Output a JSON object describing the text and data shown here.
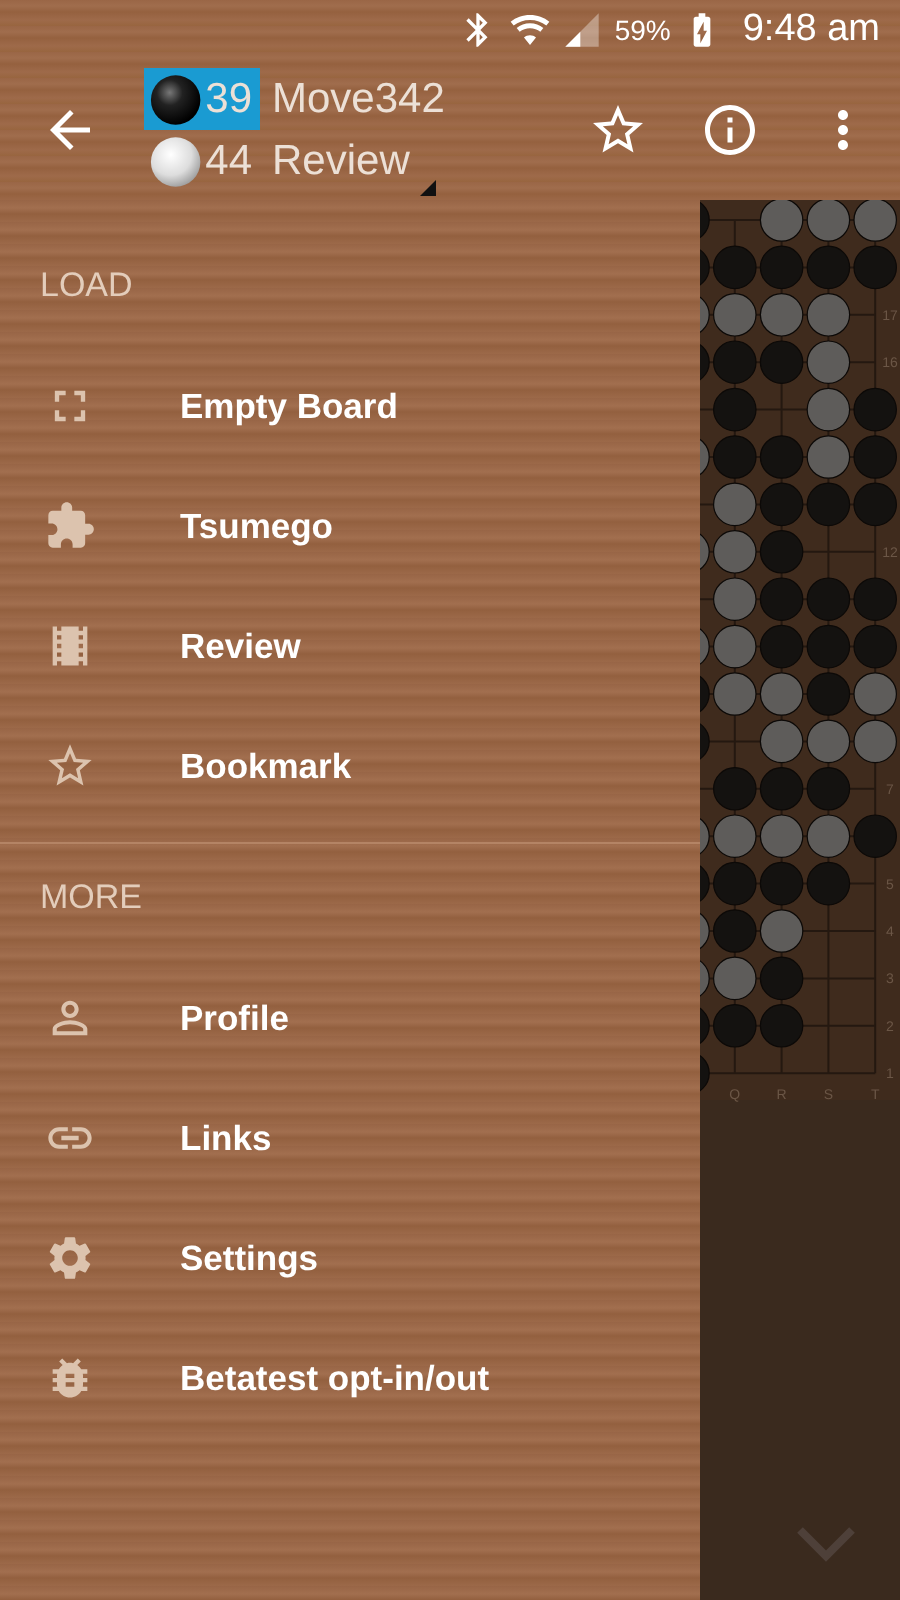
{
  "status_bar": {
    "battery": "59%",
    "time": "9:48 am"
  },
  "toolbar": {
    "players": [
      {
        "kind": "black",
        "captures": "39",
        "selected": true,
        "caption": "Move342"
      },
      {
        "kind": "white",
        "captures": "44",
        "selected": false,
        "caption": "Review"
      }
    ]
  },
  "drawer": {
    "sections": [
      {
        "header": "LOAD",
        "items": [
          {
            "label": "Empty Board"
          },
          {
            "label": "Tsumego"
          },
          {
            "label": "Review"
          },
          {
            "label": "Bookmark"
          }
        ]
      },
      {
        "header": "MORE",
        "items": [
          {
            "label": "Profile"
          },
          {
            "label": "Links"
          },
          {
            "label": "Settings"
          },
          {
            "label": "Betatest opt-in/out"
          }
        ]
      }
    ]
  },
  "board": {
    "column_labels": [
      "Q",
      "R",
      "S",
      "T"
    ],
    "rows": [
      {
        "cells": [
          {
            "kind": "black"
          },
          {
            "kind": "empty"
          },
          {
            "kind": "white"
          },
          {
            "kind": "white"
          },
          {
            "kind": "white"
          }
        ]
      },
      {
        "cells": [
          {
            "kind": "black"
          },
          {
            "kind": "black"
          },
          {
            "kind": "black"
          },
          {
            "kind": "black"
          },
          {
            "kind": "black"
          }
        ]
      },
      {
        "cells": [
          {
            "kind": "white"
          },
          {
            "kind": "white"
          },
          {
            "kind": "white"
          },
          {
            "kind": "white"
          },
          {
            "kind": "empty"
          }
        ],
        "label": "17"
      },
      {
        "cells": [
          {
            "kind": "black"
          },
          {
            "kind": "black"
          },
          {
            "kind": "black"
          },
          {
            "kind": "white"
          },
          {
            "kind": "empty"
          }
        ],
        "label": "16"
      },
      {
        "cells": [
          {
            "kind": "empty"
          },
          {
            "kind": "black"
          },
          {
            "kind": "empty"
          },
          {
            "kind": "white"
          },
          {
            "kind": "black"
          }
        ]
      },
      {
        "cells": [
          {
            "kind": "white"
          },
          {
            "kind": "black"
          },
          {
            "kind": "black"
          },
          {
            "kind": "white"
          },
          {
            "kind": "black"
          }
        ]
      },
      {
        "cells": [
          {
            "kind": "empty"
          },
          {
            "kind": "white"
          },
          {
            "kind": "black"
          },
          {
            "kind": "black"
          },
          {
            "kind": "black"
          }
        ]
      },
      {
        "cells": [
          {
            "kind": "white"
          },
          {
            "kind": "white"
          },
          {
            "kind": "black"
          },
          {
            "kind": "empty"
          },
          {
            "kind": "empty"
          }
        ],
        "label": "12"
      },
      {
        "cells": [
          {
            "kind": "empty"
          },
          {
            "kind": "white"
          },
          {
            "kind": "black"
          },
          {
            "kind": "black"
          },
          {
            "kind": "black"
          }
        ]
      },
      {
        "cells": [
          {
            "kind": "white"
          },
          {
            "kind": "white"
          },
          {
            "kind": "black"
          },
          {
            "kind": "black"
          },
          {
            "kind": "black"
          }
        ]
      },
      {
        "cells": [
          {
            "kind": "black"
          },
          {
            "kind": "white"
          },
          {
            "kind": "white"
          },
          {
            "kind": "black"
          },
          {
            "kind": "white"
          }
        ]
      },
      {
        "cells": [
          {
            "kind": "black"
          },
          {
            "kind": "empty"
          },
          {
            "kind": "white"
          },
          {
            "kind": "white"
          },
          {
            "kind": "white"
          }
        ]
      },
      {
        "cells": [
          {
            "kind": "empty"
          },
          {
            "kind": "black"
          },
          {
            "kind": "black"
          },
          {
            "kind": "black"
          },
          {
            "kind": "empty"
          }
        ],
        "label": "7"
      },
      {
        "cells": [
          {
            "kind": "white"
          },
          {
            "kind": "white"
          },
          {
            "kind": "white"
          },
          {
            "kind": "white"
          },
          {
            "kind": "black"
          }
        ]
      },
      {
        "cells": [
          {
            "kind": "black"
          },
          {
            "kind": "black"
          },
          {
            "kind": "black"
          },
          {
            "kind": "black"
          },
          {
            "kind": "empty"
          }
        ],
        "label": "5"
      },
      {
        "cells": [
          {
            "kind": "white"
          },
          {
            "kind": "black"
          },
          {
            "kind": "white"
          },
          {
            "kind": "empty"
          },
          {
            "kind": "empty"
          }
        ],
        "label": "4"
      },
      {
        "cells": [
          {
            "kind": "white"
          },
          {
            "kind": "white"
          },
          {
            "kind": "black"
          },
          {
            "kind": "empty"
          },
          {
            "kind": "empty"
          }
        ],
        "label": "3"
      },
      {
        "cells": [
          {
            "kind": "black"
          },
          {
            "kind": "black"
          },
          {
            "kind": "black"
          },
          {
            "kind": "empty"
          },
          {
            "kind": "empty"
          }
        ],
        "label": "2"
      },
      {
        "cells": [
          {
            "kind": "black"
          },
          {
            "kind": "empty"
          },
          {
            "kind": "empty"
          },
          {
            "kind": "empty"
          },
          {
            "kind": "empty"
          }
        ],
        "label": "1"
      }
    ]
  }
}
